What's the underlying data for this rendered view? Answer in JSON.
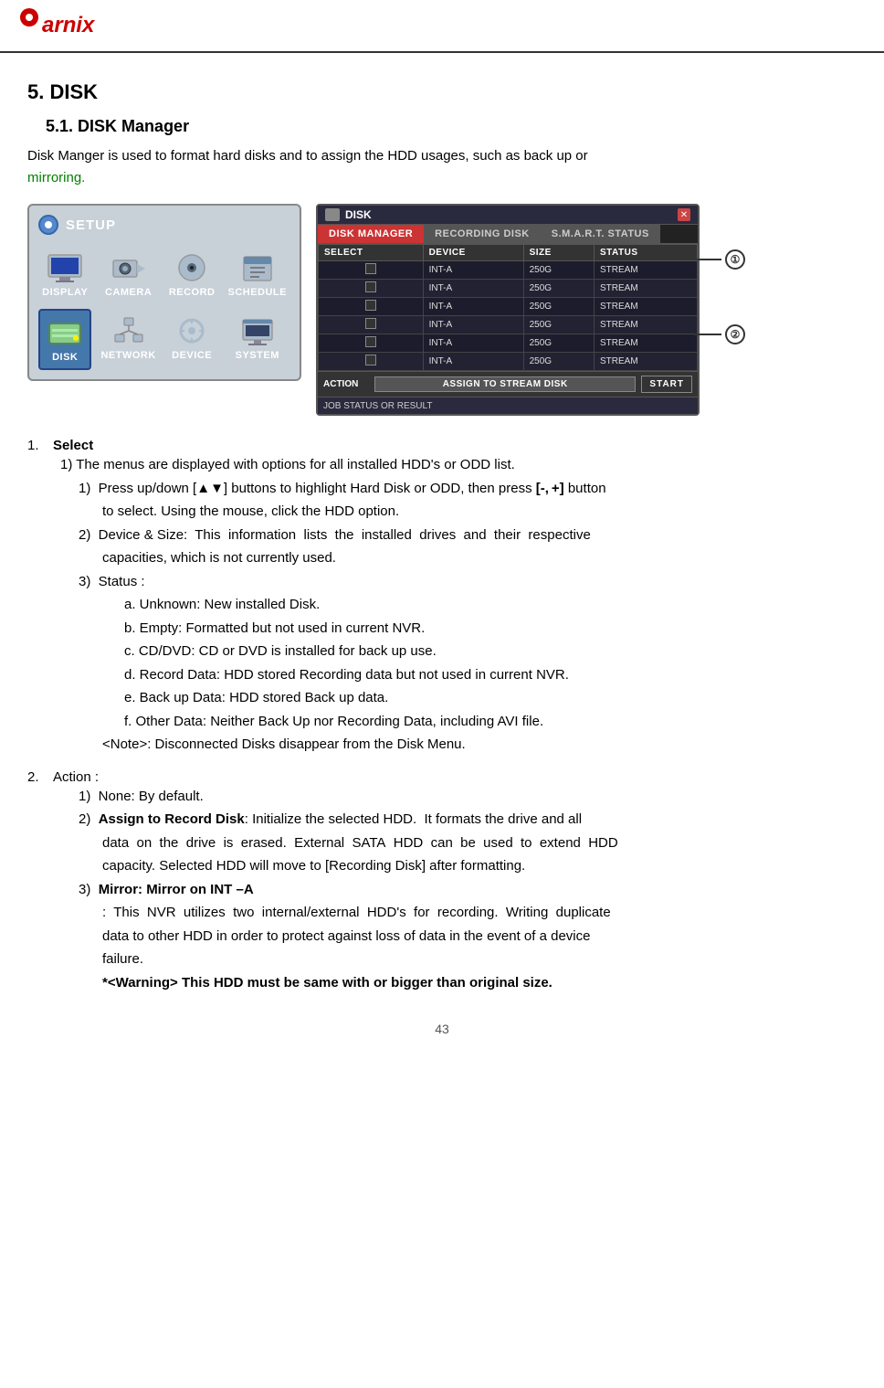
{
  "header": {
    "logo_text": "arnix",
    "logo_dot": true
  },
  "page": {
    "section_number": "5.",
    "section_title": "DISK",
    "subsection_number": "5.1.",
    "subsection_title": "DISK  Manager",
    "intro": "Disk Manger is used to format hard disks and to assign the HDD usages, such as back up or",
    "intro_green": "mirroring."
  },
  "setup_panel": {
    "title": "SETUP",
    "items": [
      {
        "label": "DISPLAY",
        "id": "display"
      },
      {
        "label": "CAMERA",
        "id": "camera"
      },
      {
        "label": "RECORD",
        "id": "record"
      },
      {
        "label": "SCHEDULE",
        "id": "schedule"
      },
      {
        "label": "DISK",
        "id": "disk",
        "active": true
      },
      {
        "label": "NETWORK",
        "id": "network"
      },
      {
        "label": "DEVICE",
        "id": "device"
      },
      {
        "label": "SYSTEM",
        "id": "system"
      }
    ]
  },
  "disk_panel": {
    "title": "DISK",
    "tabs": [
      {
        "label": "DISK MANAGER",
        "active": true
      },
      {
        "label": "RECORDING DISK",
        "active": false
      },
      {
        "label": "S.M.A.R.T. STATUS",
        "active": false
      }
    ],
    "table_headers": [
      "SELECT",
      "DEVICE",
      "SIZE",
      "STATUS"
    ],
    "table_rows": [
      {
        "select": false,
        "device": "INT-A",
        "size": "250G",
        "status": "STREAM"
      },
      {
        "select": false,
        "device": "INT-A",
        "size": "250G",
        "status": "STREAM"
      },
      {
        "select": false,
        "device": "INT-A",
        "size": "250G",
        "status": "STREAM"
      },
      {
        "select": false,
        "device": "INT-A",
        "size": "250G",
        "status": "STREAM"
      },
      {
        "select": false,
        "device": "INT-A",
        "size": "250G",
        "status": "STREAM"
      },
      {
        "select": false,
        "device": "INT-A",
        "size": "250G",
        "status": "STREAM"
      }
    ],
    "action_label": "ACTION",
    "action_dropdown": "ASSIGN TO STREAM DISK",
    "start_button": "START",
    "job_status": "JOB STATUS OR RESULT",
    "annotation_1": "①",
    "annotation_2": "②"
  },
  "numbered_list": {
    "items": [
      {
        "num": "1.",
        "title": "Select",
        "sub_items": [
          {
            "num": "1)",
            "text": "The menus are displayed with options for all installed HDD's or ODD list."
          },
          {
            "num": "1)",
            "text": "Press up/down [▲▼] buttons to highlight Hard Disk or ODD, then press [-, +] button to select. Using the mouse, click the HDD option."
          },
          {
            "num": "2)",
            "text": "Device & Size: This information lists the installed drives and their respective capacities, which is not currently used."
          },
          {
            "num": "3)",
            "text": "Status :",
            "alpha_items": [
              "a. Unknown: New installed Disk.",
              "b. Empty: Formatted but not used in current NVR.",
              "c. CD/DVD: CD or DVD is installed for back up use.",
              "d. Record Data: HDD stored Recording data but not used in current NVR.",
              "e. Back up Data: HDD stored Back up data.",
              "f. Other Data: Neither Back Up nor Recording Data, including AVI file."
            ],
            "note": "<Note>: Disconnected Disks disappear from the Disk Menu."
          }
        ]
      },
      {
        "num": "2.",
        "title": "Action :",
        "sub_items": [
          {
            "num": "1)",
            "text": "None: By default."
          },
          {
            "num": "2)",
            "bold_text": "Assign to Record Disk",
            "text": ": Initialize the selected HDD. It formats the drive and all data on the drive is erased. External SATA HDD can be used to extend HDD capacity. Selected HDD will move to [Recording Disk] after formatting."
          },
          {
            "num": "3)",
            "bold_text": "Mirror: Mirror on INT –A",
            "colon_text": ": This NVR utilizes two internal/external HDD's for recording. Writing duplicate data to other HDD in order to protect against loss of data in the event of a device failure.",
            "warning": "*<Warning> This HDD must be same with or bigger than original size."
          }
        ]
      }
    ]
  },
  "page_number": "43"
}
